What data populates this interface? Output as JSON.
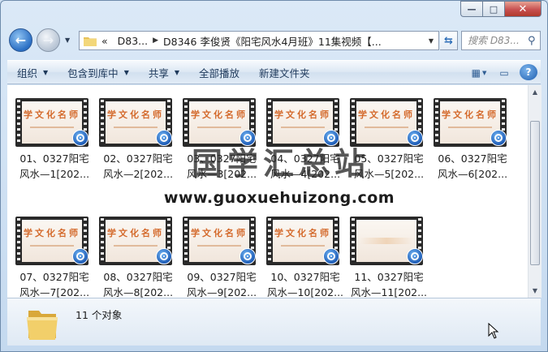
{
  "window": {
    "caption_buttons": {
      "minimize": "—",
      "maximize": "□",
      "close": "✕"
    }
  },
  "nav": {
    "back_icon": "back-arrow-icon",
    "forward_icon": "forward-arrow-icon",
    "address": {
      "overflow": "«",
      "crumbs": [
        "D83...",
        "D8346 李俊贤《阳宅风水4月班》11集视频【..."
      ]
    },
    "refresh_icon": "refresh-icon",
    "search": {
      "placeholder": "搜索 D83...",
      "icon": "search-icon"
    }
  },
  "toolbar": {
    "organize": "组织",
    "include_in_library": "包含到库中",
    "share": "共享",
    "play_all": "全部播放",
    "new_folder": "新建文件夹"
  },
  "files": [
    {
      "line1": "01、0327阳宅",
      "line2": "风水—1[202...",
      "thumb": "学文化名师"
    },
    {
      "line1": "02、0327阳宅",
      "line2": "风水—2[202...",
      "thumb": "学文化名师"
    },
    {
      "line1": "03、0327阳宅",
      "line2": "风水—3[202...",
      "thumb": "学文化名师"
    },
    {
      "line1": "04、0327阳宅",
      "line2": "风水—4[202...",
      "thumb": "学文化名师"
    },
    {
      "line1": "05、0327阳宅",
      "line2": "风水—5[202...",
      "thumb": "学文化名师"
    },
    {
      "line1": "06、0327阳宅",
      "line2": "风水—6[202...",
      "thumb": "学文化名师"
    },
    {
      "line1": "07、0327阳宅",
      "line2": "风水—7[202...",
      "thumb": "学文化名师"
    },
    {
      "line1": "08、0327阳宅",
      "line2": "风水—8[202...",
      "thumb": "学文化名师"
    },
    {
      "line1": "09、0327阳宅",
      "line2": "风水—9[202...",
      "thumb": "学文化名师"
    },
    {
      "line1": "10、0327阳宅",
      "line2": "风水—10[202...",
      "thumb": "学文化名师"
    },
    {
      "line1": "11、0327阳宅",
      "line2": "风水—11[202...",
      "thumb": ""
    }
  ],
  "watermark": {
    "title": "国学汇总站",
    "url": "www.guoxuehuizong.com"
  },
  "details": {
    "count": "11 个对象"
  }
}
